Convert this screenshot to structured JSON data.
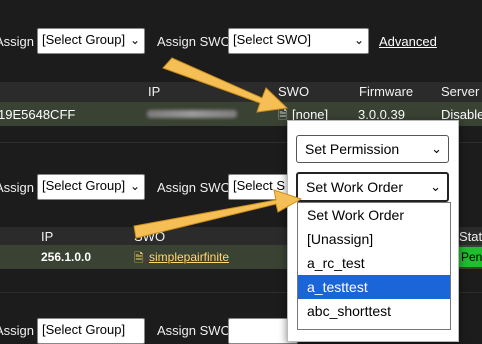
{
  "section1": {
    "assign_to_label": "Assign to",
    "group_select": "[Select Group]",
    "assign_swo_label": "Assign SWO",
    "swo_select": "[Select SWO]",
    "advanced_link": "Advanced"
  },
  "table1": {
    "headers": [
      "IP",
      "SWO",
      "Firmware",
      "Server"
    ],
    "row": {
      "device_id": "19E5648CFF",
      "swo": "[none]",
      "firmware": "3.0.0.39",
      "server": "Disable"
    }
  },
  "section2": {
    "assign_to_label": "Assign to",
    "group_select": "[Select Group]",
    "assign_swo_label": "Assign SWO",
    "swo_select": "[Select S"
  },
  "table2": {
    "headers": [
      "IP",
      "SWO",
      "Stat"
    ],
    "row": {
      "ip": "256.1.0.0",
      "swo": "simplepairfinite",
      "status": "Pen"
    }
  },
  "section3": {
    "assign_to_label": "Assign to",
    "group_select": "[Select Group]",
    "assign_swo_label": "Assign SWO"
  },
  "popup": {
    "permission_select": "Set Permission",
    "work_order_select": "Set Work Order",
    "options": [
      "Set Work Order",
      "[Unassign]",
      "a_rc_test",
      "a_testtest",
      "abc_shorttest"
    ],
    "highlighted": "a_testtest"
  },
  "colors": {
    "arrow": "#f6bf56",
    "highlight": "#1a66d8",
    "status_green": "#1fbe2e",
    "row_bg": "#3a4233"
  },
  "icons": [
    "chevron-down-icon",
    "document-icon",
    "arrow-annotation"
  ]
}
